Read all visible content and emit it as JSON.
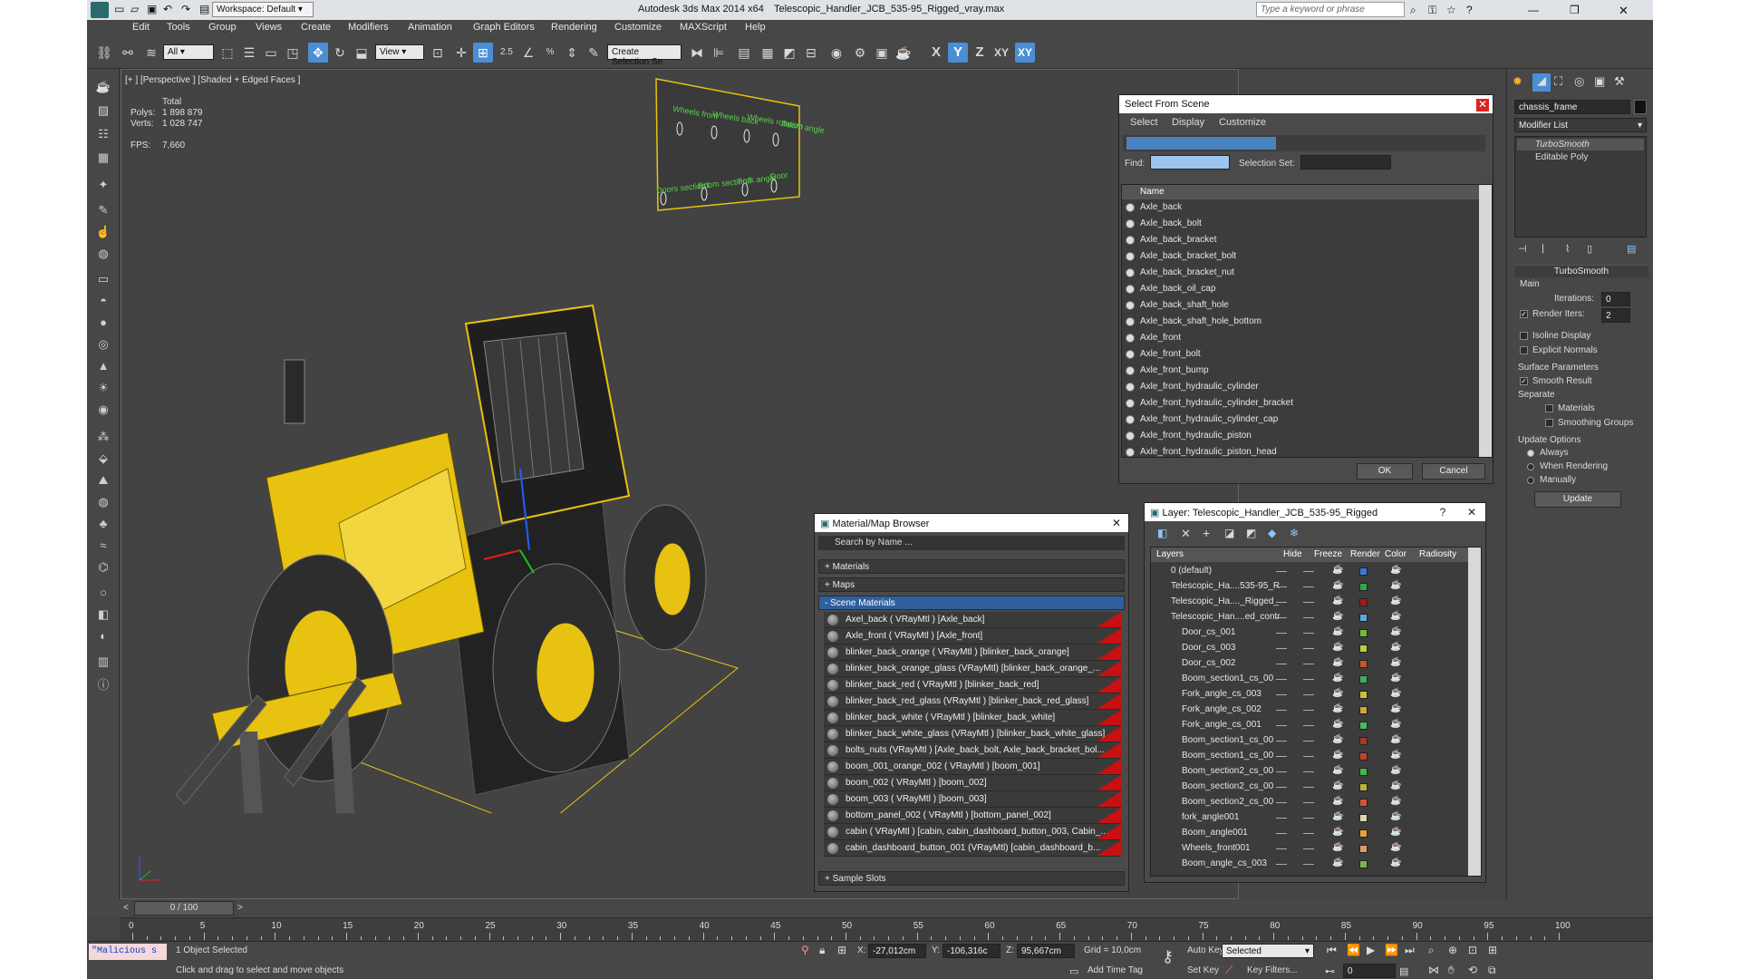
{
  "title_bar": {
    "workspace": "Workspace: Default",
    "app_title": "Autodesk 3ds Max  2014 x64",
    "file_name": "Telescopic_Handler_JCB_535-95_Rigged_vray.max",
    "search_placeholder": "Type a keyword or phrase"
  },
  "menu": [
    "Edit",
    "Tools",
    "Group",
    "Views",
    "Create",
    "Modifiers",
    "Animation",
    "Graph Editors",
    "Rendering",
    "Customize",
    "MAXScript",
    "Help"
  ],
  "toolbar": {
    "selection_filter": "All",
    "ref_coord": "View",
    "named_selection": "Create Selection Se",
    "axis_labels": [
      "X",
      "Y",
      "Z",
      "XY",
      "XY"
    ],
    "snap_label": "2.5",
    "percent_label": "%"
  },
  "viewport": {
    "label": "[+ ] [Perspective ] [Shaded + Edged Faces ]",
    "stats_header": "Total",
    "polys_label": "Polys:",
    "polys_value": "1 898 879",
    "verts_label": "Verts:",
    "verts_value": "1 028 747",
    "fps_label": "FPS:",
    "fps_value": "7,660",
    "rig_labels": [
      "Wheels front",
      "Wheels back",
      "Wheels rotation",
      "Boom angle",
      "Doors section1",
      "Boom section2",
      "Fork angle",
      "Door"
    ]
  },
  "select_scene": {
    "title": "Select From Scene",
    "menu": [
      "Select",
      "Display",
      "Customize"
    ],
    "find_label": "Find:",
    "selection_set_label": "Selection Set:",
    "column": "Name",
    "items": [
      "Axle_back",
      "Axle_back_bolt",
      "Axle_back_bracket",
      "Axle_back_bracket_bolt",
      "Axle_back_bracket_nut",
      "Axle_back_oil_cap",
      "Axle_back_shaft_hole",
      "Axle_back_shaft_hole_bottom",
      "Axle_front",
      "Axle_front_bolt",
      "Axle_front_bump",
      "Axle_front_hydraulic_cylinder",
      "Axle_front_hydraulic_cylinder_bracket",
      "Axle_front_hydraulic_cylinder_cap",
      "Axle_front_hydraulic_piston",
      "Axle_front_hydraulic_piston_head"
    ],
    "ok": "OK",
    "cancel": "Cancel"
  },
  "material_browser": {
    "title": "Material/Map Browser",
    "search_placeholder": "Search by Name ...",
    "sections": [
      "+ Materials",
      "+ Maps",
      "- Scene Materials",
      "+ Sample Slots"
    ],
    "items": [
      "Axel_back  ( VRayMtl )  [Axle_back]",
      "Axle_front  ( VRayMtl )  [Axle_front]",
      "blinker_back_orange  ( VRayMtl )  [blinker_back_orange]",
      "blinker_back_orange_glass  (VRayMtl) [blinker_back_orange_...",
      "blinker_back_red  ( VRayMtl )  [blinker_back_red]",
      "blinker_back_red_glass  (VRayMtl ) [blinker_back_red_glass]",
      "blinker_back_white  ( VRayMtl )  [blinker_back_white]",
      "blinker_back_white_glass  (VRayMtl ) [blinker_back_white_glass]",
      "bolts_nuts  (VRayMtl ) [Axle_back_bolt, Axle_back_bracket_bol...",
      "boom_001_orange_002  ( VRayMtl )  [boom_001]",
      "boom_002  ( VRayMtl )  [boom_002]",
      "boom_003  ( VRayMtl )  [boom_003]",
      "bottom_panel_002  ( VRayMtl )  [bottom_panel_002]",
      "cabin  ( VRayMtl )  [cabin, cabin_dashboard_button_003, Cabin_...",
      "cabin_dashboard_button_001  (VRayMtl) [cabin_dashboard_b..."
    ]
  },
  "layer_dialog": {
    "title": "Layer: Telescopic_Handler_JCB_535-95_Rigged",
    "columns": [
      "Layers",
      "Hide",
      "Freeze",
      "Render",
      "Color",
      "Radiosity"
    ],
    "rows": [
      {
        "name": "0 (default)",
        "indent": 0,
        "color": "#3a78d8"
      },
      {
        "name": "Telescopic_Ha....535-95_R",
        "indent": 0,
        "color": "#2fa84a"
      },
      {
        "name": "Telescopic_Ha...._Rigged_",
        "indent": 0,
        "color": "#a01818"
      },
      {
        "name": "Telescopic_Han....ed_contr",
        "indent": 0,
        "color": "#59a9d8"
      },
      {
        "name": "Door_cs_001",
        "indent": 1,
        "color": "#6fbf3a"
      },
      {
        "name": "Door_cs_003",
        "indent": 1,
        "color": "#b9d43a"
      },
      {
        "name": "Door_cs_002",
        "indent": 1,
        "color": "#c45a2a"
      },
      {
        "name": "Boom_section1_cs_00",
        "indent": 1,
        "color": "#3fae5f"
      },
      {
        "name": "Fork_angle_cs_003",
        "indent": 1,
        "color": "#c9c23a"
      },
      {
        "name": "Fork_angle_cs_002",
        "indent": 1,
        "color": "#d4a53a"
      },
      {
        "name": "Fork_angle_cs_001",
        "indent": 1,
        "color": "#4bb85a"
      },
      {
        "name": "Boom_section1_cs_00",
        "indent": 1,
        "color": "#a43a2a"
      },
      {
        "name": "Boom_section1_cs_00",
        "indent": 1,
        "color": "#c4422a"
      },
      {
        "name": "Boom_section2_cs_00",
        "indent": 1,
        "color": "#43b54b"
      },
      {
        "name": "Boom_section2_cs_00",
        "indent": 1,
        "color": "#b5b53a"
      },
      {
        "name": "Boom_section2_cs_00",
        "indent": 1,
        "color": "#d4543a"
      },
      {
        "name": "fork_angle001",
        "indent": 1,
        "color": "#d8d8a8"
      },
      {
        "name": "Boom_angle001",
        "indent": 1,
        "color": "#e6a33a"
      },
      {
        "name": "Wheels_front001",
        "indent": 1,
        "color": "#e39a6a"
      },
      {
        "name": "Boom_angle_cs_003",
        "indent": 1,
        "color": "#7ab84a"
      }
    ]
  },
  "command_panel": {
    "object_name": "chassis_frame",
    "modifier_list": "Modifier List",
    "stack": [
      "TurboSmooth",
      "Editable Poly"
    ],
    "rollout_title": "TurboSmooth",
    "main_label": "Main",
    "iterations_label": "Iterations:",
    "iterations_value": "0",
    "render_iters_label": "Render Iters:",
    "render_iters_value": "2",
    "isoline_display": "Isoline Display",
    "explicit_normals": "Explicit Normals",
    "surface_params": "Surface Parameters",
    "smooth_result": "Smooth Result",
    "separate": "Separate",
    "materials": "Materials",
    "smoothing_groups": "Smoothing Groups",
    "update_options": "Update Options",
    "always": "Always",
    "when_rendering": "When Rendering",
    "manually": "Manually",
    "update_button": "Update"
  },
  "timeline": {
    "frame_counter": "0 / 100",
    "ticks": [
      "0",
      "5",
      "10",
      "15",
      "20",
      "25",
      "30",
      "35",
      "40",
      "45",
      "50",
      "55",
      "60",
      "65",
      "70",
      "75",
      "80",
      "85",
      "90",
      "95",
      "100"
    ]
  },
  "status": {
    "maxscript": "\"Malicious s",
    "selected": "1 Object Selected",
    "prompt": "Click and drag to select and move objects",
    "x_label": "X:",
    "x_value": "-27,012cm",
    "y_label": "Y:",
    "y_value": "-106,316c",
    "z_label": "Z:",
    "z_value": "95,667cm",
    "grid": "Grid = 10,0cm",
    "add_time_tag": "Add Time Tag",
    "auto_key": "Auto Key",
    "set_key": "Set Key",
    "selected_combo": "Selected",
    "key_filters": "Key Filters...",
    "frame_value": "0"
  },
  "colors": {
    "accent": "#4a8fd6",
    "scene_materials_header": "#2f5f9f",
    "swatch_red": "#c81010",
    "yellow_model": "#e8c210",
    "rig_green": "#58d04a"
  }
}
